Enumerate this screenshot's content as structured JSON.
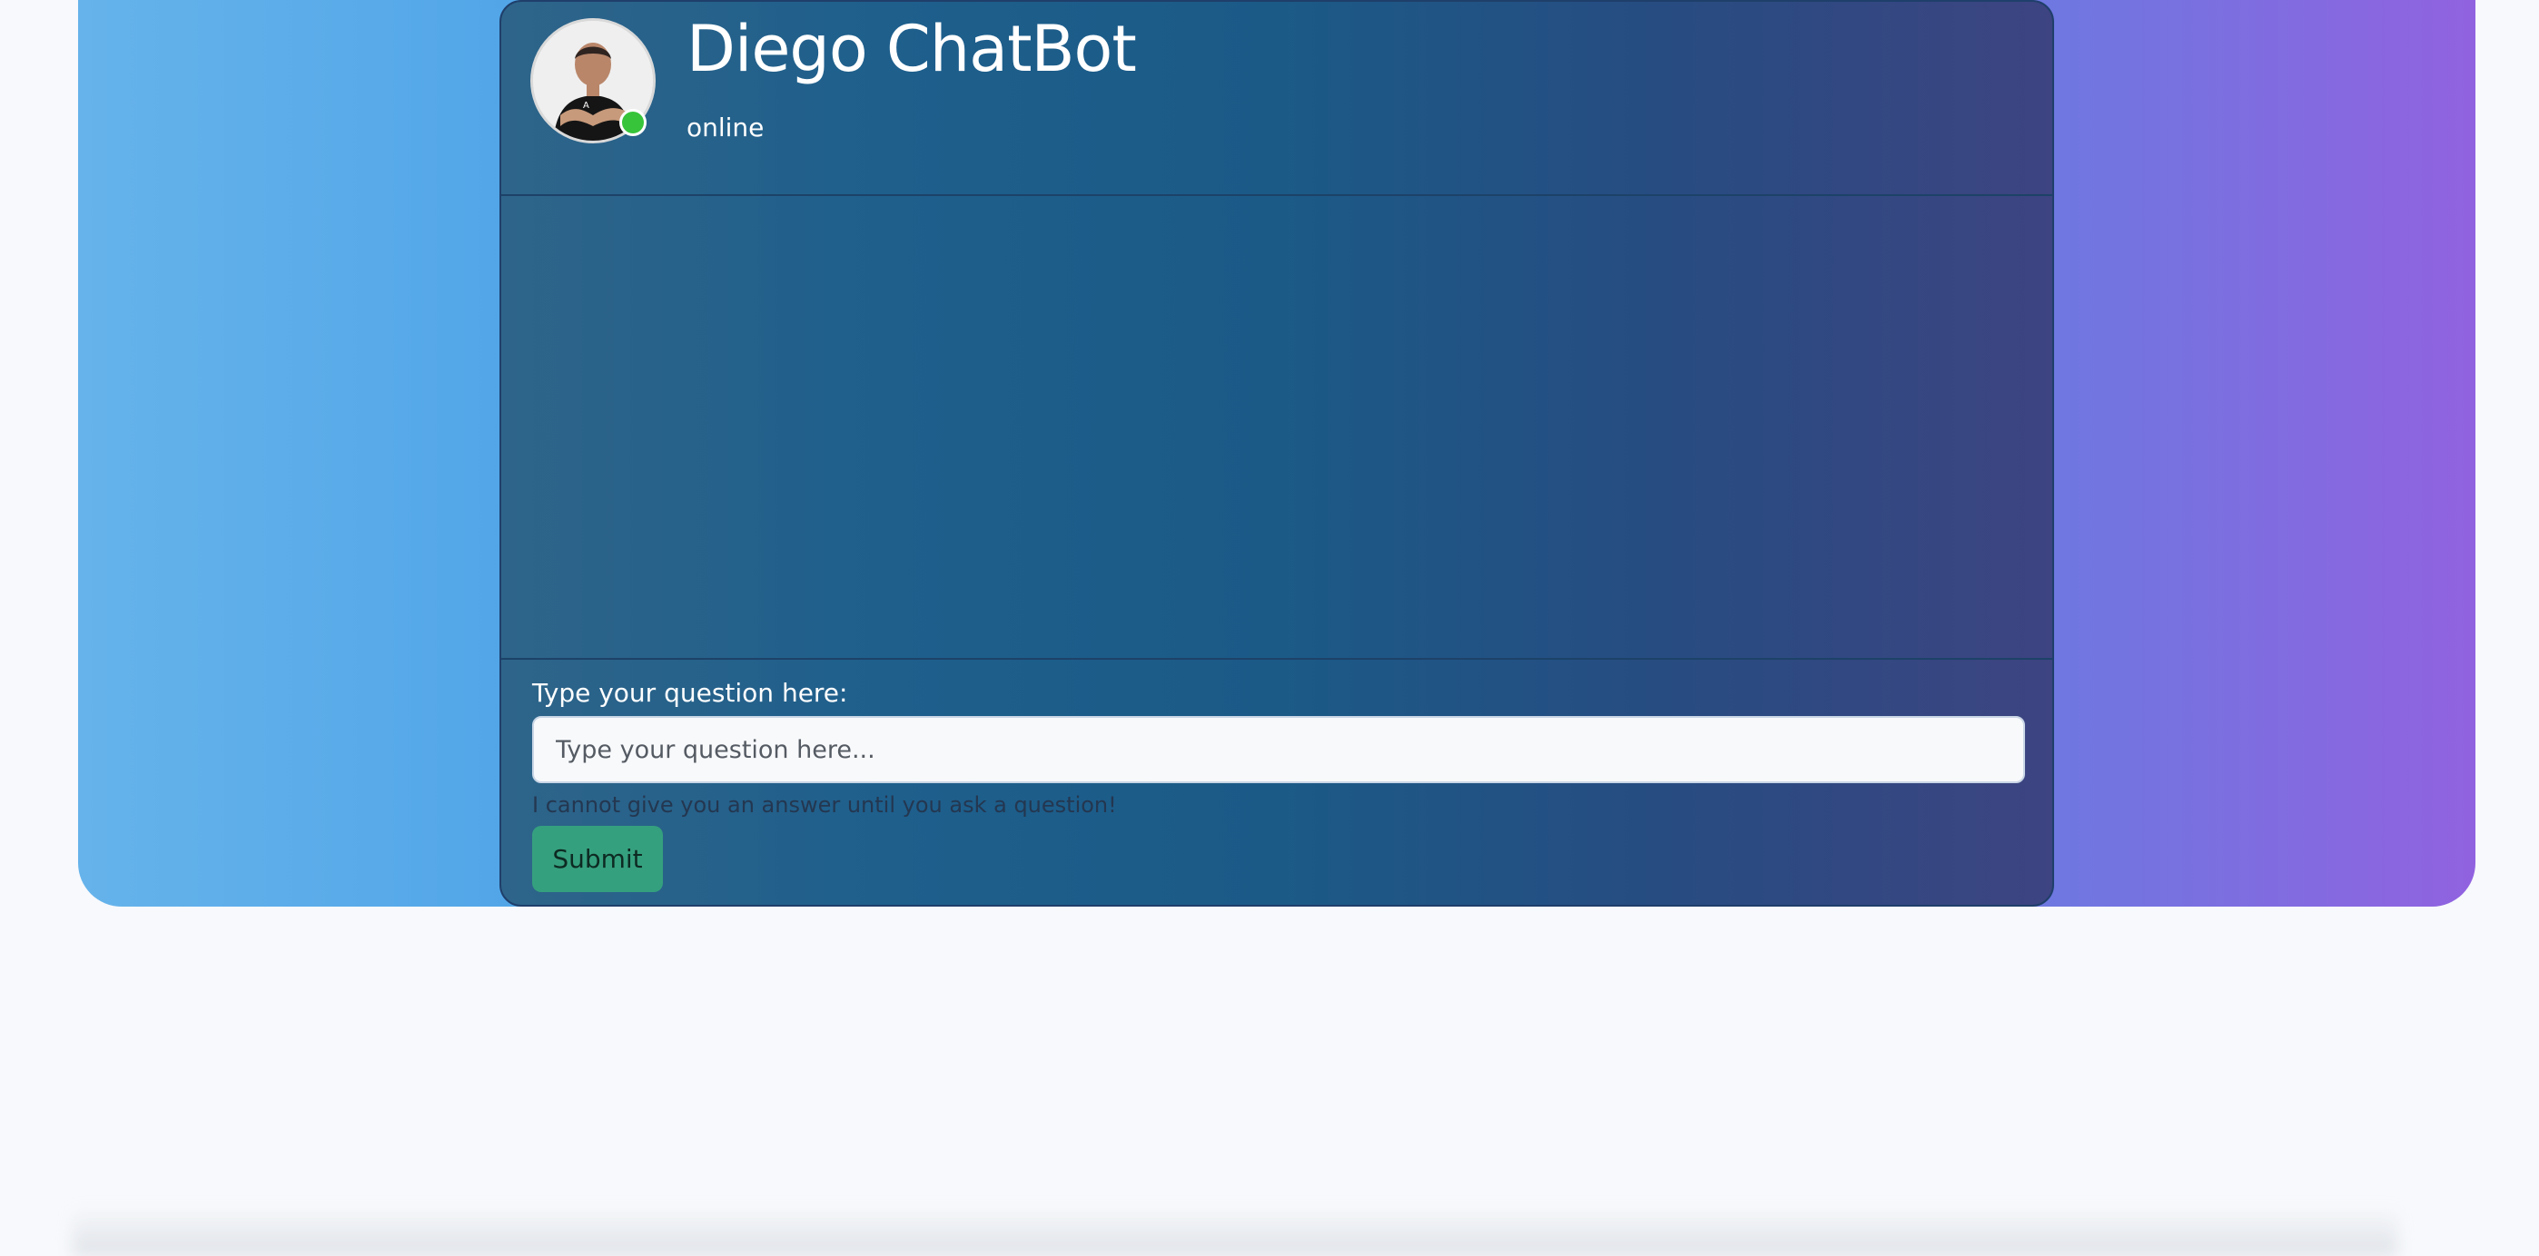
{
  "header": {
    "bot_name": "Diego ChatBot",
    "status": "online",
    "status_color": "#37c43a"
  },
  "form": {
    "label": "Type your question here:",
    "input_placeholder": "Type your question here...",
    "input_value": "",
    "help_text": "I cannot give you an answer until you ask a question!",
    "submit_label": "Submit"
  },
  "colors": {
    "page_background": "#f7f9fc",
    "hero_gradient_start": "#66b3eb",
    "hero_gradient_end": "#9162e0",
    "card_gradient_start": "#2e6489",
    "card_gradient_end": "#3d4481",
    "submit_button": "#35a07e"
  },
  "icons": {
    "avatar": "user-photo-avatar",
    "status": "online-status-dot"
  }
}
